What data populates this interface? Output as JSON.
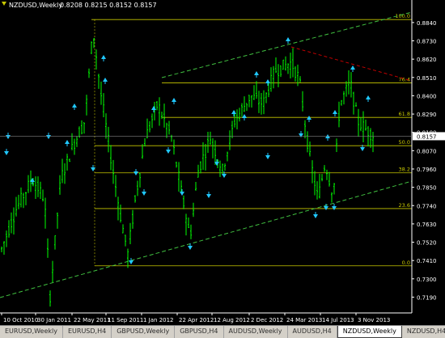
{
  "window": {
    "title": "NZDUSD,Weekly",
    "ohlc": "0.8208 0.8215 0.8152 0.8157",
    "current_price": "0.8157"
  },
  "price_axis": {
    "min": 0.7095,
    "max": 0.8922,
    "labels": [
      "0.8840",
      "0.8730",
      "0.8620",
      "0.8510",
      "0.8400",
      "0.8290",
      "0.8180",
      "0.8070",
      "0.7960",
      "0.7850",
      "0.7740",
      "0.7630",
      "0.7520",
      "0.7410",
      "0.7300",
      "0.7190"
    ]
  },
  "time_axis": {
    "labels": [
      "10 Oct 2010",
      "30 Jan 2011",
      "22 May 2011",
      "11 Sep 2011",
      "1 Jan 2012",
      "22 Apr 2012",
      "12 Aug 2012",
      "2 Dec 2012",
      "24 Mar 2013",
      "14 Jul 2013",
      "3 Nov 2013"
    ]
  },
  "fibonacci": {
    "color": "#c8c800",
    "levels": [
      {
        "label": "100.0",
        "price": 0.8858
      },
      {
        "label": "76.4",
        "price": 0.8477
      },
      {
        "label": "61.8",
        "price": 0.827
      },
      {
        "label": "50.0",
        "price": 0.81
      },
      {
        "label": "38.2",
        "price": 0.7937
      },
      {
        "label": "23.6",
        "price": 0.7722
      },
      {
        "label": "0.0",
        "price": 0.7378
      }
    ]
  },
  "colors": {
    "background": "#000000",
    "candle": "#00ff00",
    "channel": "#40c040",
    "resistance": "#c00000",
    "fractal": "#20c8ff",
    "axis_text": "#ffffff",
    "price_label_bg": "#ffffff"
  },
  "tabs": [
    {
      "label": "EURUSD,Weekly",
      "active": false
    },
    {
      "label": "EURUSD,H4",
      "active": false
    },
    {
      "label": "GBPUSD,Weekly",
      "active": false
    },
    {
      "label": "GBPUSD,H4",
      "active": false
    },
    {
      "label": "AUDUSD,Weekly",
      "active": false
    },
    {
      "label": "AUDUSD,H4",
      "active": false
    },
    {
      "label": "NZDUSD,Weekly",
      "active": true
    },
    {
      "label": "NZDUSD,H4",
      "active": false
    },
    {
      "label": "USDX",
      "active": false
    }
  ]
}
